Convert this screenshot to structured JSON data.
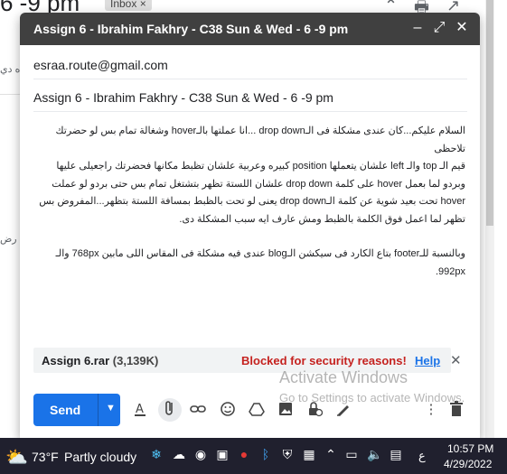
{
  "background": {
    "subject_fragment": "6 -9 pm",
    "inbox_badge": "Inbox ×",
    "side_text_1": "ه دي",
    "side_text_2": "رض"
  },
  "compose": {
    "title": "Assign 6 - Ibrahim Fakhry - C38 Sun & Wed - 6 -9 pm",
    "to": "esraa.route@gmail.com",
    "subject": "Assign 6 - Ibrahim Fakhry - C38 Sun & Wed - 6 -9 pm",
    "body_lines": [
      "السلام عليكم...كان عندى مشكلة فى الـdrop down ...انا عملتها بالـhover وشغالة تمام بس لو حضرتك تلاحظى",
      "قيم الـ top والـ left علشان يتعملها position كبيره وعربية علشان تظبط مكانها فحضرتك راجعيلى عليها",
      "وبردو لما بعمل hover على كلمة drop down علشان اللستة تظهر بتشتغل تمام بس حتى بردو لو عملت",
      "hover تحت بعيد شوية عن كلمة الـdrop down يعنى لو تحت بالظبط بمسافة اللستة بتظهر...المفروض بس",
      "تظهر لما اعمل فوق الكلمة بالظبط ومش عارف ايه سبب المشكلة دى.",
      "وبالنسبة للـfooter بتاع الكارد فى سيكشن الـblog عندى فيه مشكلة فى المقاس اللى مابين 768px والـ 992px."
    ],
    "attachment": {
      "name": "Assign 6.rar",
      "size": "(3,139K)",
      "blocked_text": "Blocked for security reasons!",
      "help_label": "Help"
    },
    "send_label": "Send"
  },
  "watermark": {
    "line1": "Activate Windows",
    "line2": "Go to Settings to activate Windows."
  },
  "taskbar": {
    "temperature": "73°F",
    "condition": "Partly cloudy",
    "language": "ع",
    "time": "10:57 PM",
    "date": "4/29/2022"
  },
  "colors": {
    "header_bg": "#404040",
    "send_blue": "#1a73e8",
    "blocked_red": "#c5221f",
    "taskbar_bg": "#20202e"
  }
}
